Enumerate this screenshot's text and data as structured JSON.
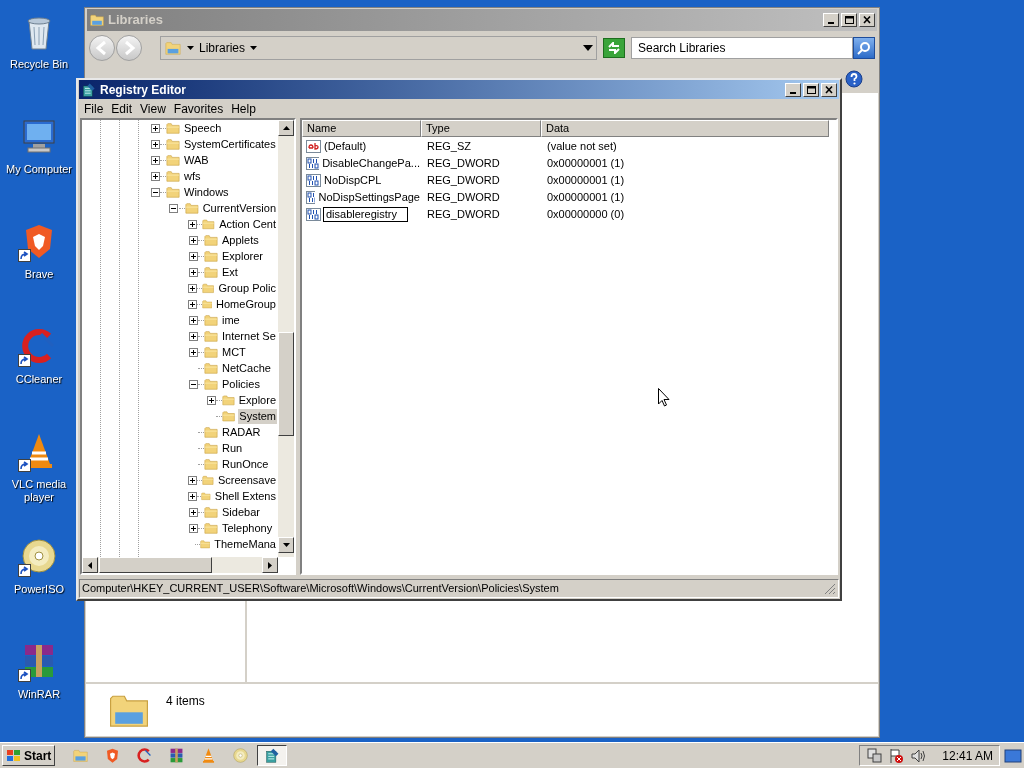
{
  "desktop_icons": [
    {
      "label": "Recycle Bin",
      "kind": "recycle",
      "shortcut": false
    },
    {
      "label": "My Computer",
      "kind": "computer",
      "shortcut": false
    },
    {
      "label": "Brave",
      "kind": "brave",
      "shortcut": true
    },
    {
      "label": "CCleaner",
      "kind": "ccleaner",
      "shortcut": true
    },
    {
      "label": "VLC media player",
      "kind": "vlc",
      "shortcut": true
    },
    {
      "label": "PowerISO",
      "kind": "disc",
      "shortcut": true
    },
    {
      "label": "WinRAR",
      "kind": "winrar",
      "shortcut": true
    }
  ],
  "libraries_window": {
    "title": "Libraries",
    "address": "Libraries",
    "search": {
      "placeholder": "Search Libraries"
    },
    "details": "4 items"
  },
  "registry_editor": {
    "title": "Registry Editor",
    "menu": [
      "File",
      "Edit",
      "View",
      "Favorites",
      "Help"
    ],
    "tree": [
      {
        "label": "Speech",
        "expanded": false
      },
      {
        "label": "SystemCertificates",
        "expanded": false
      },
      {
        "label": "WAB",
        "expanded": false
      },
      {
        "label": "wfs",
        "expanded": false
      },
      {
        "label": "Windows",
        "expanded": true,
        "children": [
          {
            "label": "CurrentVersion",
            "expanded": true,
            "children": [
              {
                "label": "Action Cent",
                "expanded": false
              },
              {
                "label": "Applets",
                "expanded": false
              },
              {
                "label": "Explorer",
                "expanded": false
              },
              {
                "label": "Ext",
                "expanded": false
              },
              {
                "label": "Group Polic",
                "expanded": false
              },
              {
                "label": "HomeGroup",
                "expanded": false
              },
              {
                "label": "ime",
                "expanded": false
              },
              {
                "label": "Internet Se",
                "expanded": false
              },
              {
                "label": "MCT",
                "expanded": false
              },
              {
                "label": "NetCache"
              },
              {
                "label": "Policies",
                "expanded": true,
                "children": [
                  {
                    "label": "Explore",
                    "expanded": false,
                    "selected": false
                  },
                  {
                    "label": "System",
                    "selected": true
                  }
                ]
              },
              {
                "label": "RADAR"
              },
              {
                "label": "Run"
              },
              {
                "label": "RunOnce"
              },
              {
                "label": "Screensave",
                "expanded": false
              },
              {
                "label": "Shell Extens",
                "expanded": false
              },
              {
                "label": "Sidebar",
                "expanded": false
              },
              {
                "label": "Telephony",
                "expanded": false
              },
              {
                "label": "ThemeMana"
              }
            ]
          }
        ]
      }
    ],
    "columns": [
      "Name",
      "Type",
      "Data"
    ],
    "values": [
      {
        "kind": "string",
        "name": "(Default)",
        "type": "REG_SZ",
        "data": "(value not set)",
        "editing": false
      },
      {
        "kind": "binary",
        "name": "DisableChangePa...",
        "type": "REG_DWORD",
        "data": "0x00000001 (1)",
        "editing": false
      },
      {
        "kind": "binary",
        "name": "NoDispCPL",
        "type": "REG_DWORD",
        "data": "0x00000001 (1)",
        "editing": false
      },
      {
        "kind": "binary",
        "name": "NoDispSettingsPage",
        "type": "REG_DWORD",
        "data": "0x00000001 (1)",
        "editing": false
      },
      {
        "kind": "binary",
        "name": "disableregistry",
        "type": "REG_DWORD",
        "data": "0x00000000 (0)",
        "editing": true
      }
    ],
    "status_bar": "Computer\\HKEY_CURRENT_USER\\Software\\Microsoft\\Windows\\CurrentVersion\\Policies\\System"
  },
  "taskbar": {
    "start": "Start",
    "apps": [
      {
        "kind": "explorer",
        "selected": false
      },
      {
        "kind": "brave",
        "selected": false
      },
      {
        "kind": "ccleaner",
        "selected": false
      },
      {
        "kind": "winrar",
        "selected": false
      },
      {
        "kind": "vlc",
        "selected": false
      },
      {
        "kind": "disc",
        "selected": false
      },
      {
        "kind": "regedit",
        "selected": true
      }
    ],
    "clock": "12:41 AM"
  }
}
